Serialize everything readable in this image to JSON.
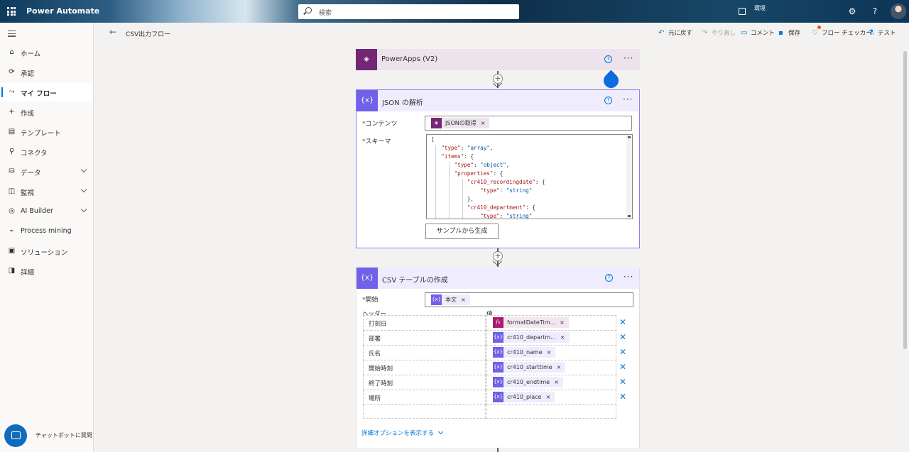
{
  "app": {
    "title": "Power Automate"
  },
  "search": {
    "placeholder": "検索"
  },
  "environment": {
    "label": "環境"
  },
  "leftnav": {
    "items": [
      {
        "label": "ホーム",
        "icon": "home-icon"
      },
      {
        "label": "承認",
        "icon": "approvals-icon"
      },
      {
        "label": "マイ フロー",
        "icon": "flow-icon",
        "active": true
      },
      {
        "label": "作成",
        "icon": "plus-icon"
      },
      {
        "label": "テンプレート",
        "icon": "template-icon"
      },
      {
        "label": "コネクタ",
        "icon": "connector-icon"
      },
      {
        "label": "データ",
        "icon": "database-icon",
        "expandable": true
      },
      {
        "label": "監視",
        "icon": "monitor-icon",
        "expandable": true
      },
      {
        "label": "AI Builder",
        "icon": "ai-builder-icon",
        "expandable": true
      },
      {
        "label": "Process mining",
        "icon": "process-mining-icon"
      },
      {
        "label": "ソリューション",
        "icon": "solutions-icon"
      },
      {
        "label": "詳細",
        "icon": "book-icon"
      }
    ],
    "chatbot_label": "チャットボットに質問"
  },
  "commandbar": {
    "breadcrumb": "CSV出力フロー",
    "undo": "元に戻す",
    "redo": "やり直し",
    "comment": "コメント",
    "save": "保存",
    "flow_checker": "フロー チェッカー",
    "test": "テスト"
  },
  "cards": {
    "trigger": {
      "title": "PowerApps (V2)",
      "color": "#742774"
    },
    "parse_json": {
      "title": "JSON の解析",
      "color": "#7160e8",
      "content_label": "コンテンツ",
      "content_token": "JSONの取得",
      "schema_label": "スキーマ",
      "schema_lines": [
        "[",
        "    \"type\": \"array\",",
        "    \"items\": {",
        "        \"type\": \"object\",",
        "        \"properties\": {",
        "            \"cr410_recordingdate\": {",
        "                \"type\": \"string\"",
        "            },",
        "            \"cr410_department\": {",
        "                \"type\": \"string\""
      ],
      "sample_button": "サンプルから生成"
    },
    "csv_table": {
      "title": "CSV テーブルの作成",
      "color": "#7160e8",
      "from_label": "開始",
      "from_token": "本文",
      "header_col": "ヘッダー",
      "value_col": "値",
      "rows": [
        {
          "header": "打刻日",
          "value": "formatDateTim...",
          "type": "expression"
        },
        {
          "header": "部署",
          "value": "cr410_departm...",
          "type": "dynamic"
        },
        {
          "header": "氏名",
          "value": "cr410_name",
          "type": "dynamic"
        },
        {
          "header": "開始時刻",
          "value": "cr410_starttime",
          "type": "dynamic"
        },
        {
          "header": "終了時刻",
          "value": "cr410_endtime",
          "type": "dynamic"
        },
        {
          "header": "場所",
          "value": "cr410_place",
          "type": "dynamic"
        }
      ],
      "advanced_options": "詳細オプションを表示する"
    }
  }
}
